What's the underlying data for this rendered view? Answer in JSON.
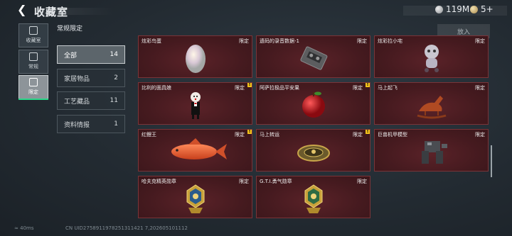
{
  "header": {
    "title": "收藏室",
    "currency1": "119M",
    "currency2": "5+"
  },
  "sidebar": {
    "items": [
      {
        "label": "收藏室",
        "icon": "avatar-icon"
      },
      {
        "label": "常规",
        "icon": "document-icon"
      },
      {
        "label": "限定",
        "icon": "picture-icon"
      }
    ]
  },
  "section_title": "常规限定",
  "filters": [
    {
      "label": "全部",
      "count": "14"
    },
    {
      "label": "家居物品",
      "count": "2"
    },
    {
      "label": "工艺藏品",
      "count": "11"
    },
    {
      "label": "资料情报",
      "count": "1"
    }
  ],
  "put_button": "放入",
  "cards": [
    {
      "name": "炫彩鸟蛋",
      "tag": "限定",
      "icon": "egg-icon"
    },
    {
      "name": "遗码的录音数据-1",
      "tag": "限定",
      "icon": "cassette-icon"
    },
    {
      "name": "炫彩拉小宅",
      "tag": "限定",
      "icon": "doll-icon"
    },
    {
      "name": "比利的面具娘",
      "tag": "限定",
      "icon": "puppet-icon",
      "warn": "!"
    },
    {
      "name": "阿萨拉极品平安果",
      "tag": "限定",
      "icon": "apple-icon",
      "warn": "!"
    },
    {
      "name": "马上起飞",
      "tag": "限定",
      "icon": "horse-icon"
    },
    {
      "name": "红鲤王",
      "tag": "限定",
      "icon": "fish-icon",
      "warn": "!"
    },
    {
      "name": "马上转运",
      "tag": "限定",
      "icon": "compass-icon",
      "warn": "!"
    },
    {
      "name": "巨兽机甲模型",
      "tag": "限定",
      "icon": "mech-icon"
    },
    {
      "name": "哈夫克精英勋章",
      "tag": "限定",
      "icon": "medal-icon"
    },
    {
      "name": "G.T.I.勇气勋章",
      "tag": "限定",
      "icon": "medal-icon"
    }
  ],
  "footer": {
    "ping": "40ms",
    "uid": "CN UID2758911978251311421 7,202605101112"
  }
}
